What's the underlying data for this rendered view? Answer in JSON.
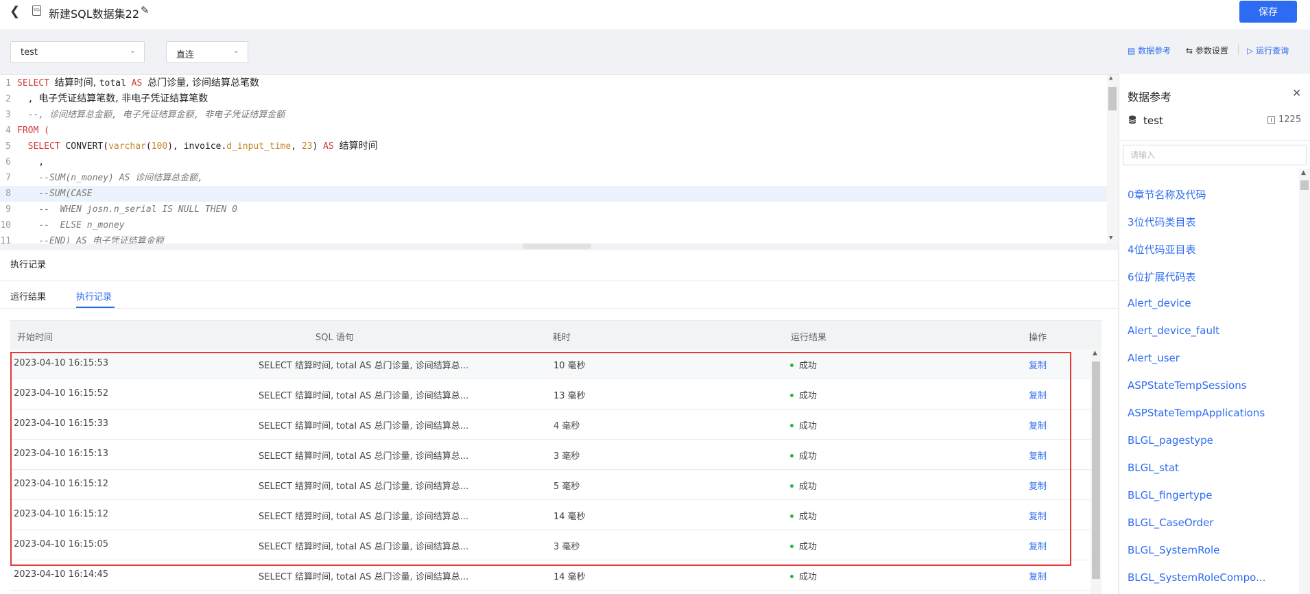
{
  "header": {
    "back_icon": "chevron-left-icon",
    "file_icon": "sql-file-icon",
    "title": "新建SQL数据集22",
    "edit_icon": "pencil-icon",
    "save_label": "保存"
  },
  "toolbar": {
    "datasource_select": "test",
    "mode_select": "直连",
    "data_reference": "数据参考",
    "param_settings": "参数设置",
    "run_query": "运行查询"
  },
  "editor": {
    "highlighted_line": 8,
    "lines": [
      {
        "n": "1",
        "parts": [
          {
            "t": "SELECT ",
            "c": "kw"
          },
          {
            "t": "结算时间, ",
            "c": "cn"
          },
          {
            "t": "total ",
            "c": ""
          },
          {
            "t": "AS ",
            "c": "kw"
          },
          {
            "t": "总门诊量, 诊间结算总笔数",
            "c": "cn"
          }
        ]
      },
      {
        "n": "2",
        "parts": [
          {
            "t": "  , ",
            "c": ""
          },
          {
            "t": "电子凭证结算笔数, 非电子凭证结算笔数",
            "c": "cn"
          }
        ]
      },
      {
        "n": "3",
        "parts": [
          {
            "t": "  --, 诊间结算总金额, 电子凭证结算金额, 非电子凭证结算金额",
            "c": "cm"
          }
        ]
      },
      {
        "n": "4",
        "parts": [
          {
            "t": "FROM (",
            "c": "kw"
          }
        ]
      },
      {
        "n": "5",
        "parts": [
          {
            "t": "  SELECT ",
            "c": "kw"
          },
          {
            "t": "CONVERT(",
            "c": ""
          },
          {
            "t": "varchar",
            "c": "fn"
          },
          {
            "t": "(",
            "c": ""
          },
          {
            "t": "100",
            "c": "fn"
          },
          {
            "t": "), invoice.",
            "c": ""
          },
          {
            "t": "d_input_time",
            "c": "fn"
          },
          {
            "t": ", ",
            "c": ""
          },
          {
            "t": "23",
            "c": "fn"
          },
          {
            "t": ") ",
            "c": ""
          },
          {
            "t": "AS ",
            "c": "kw"
          },
          {
            "t": "结算时间",
            "c": "cn"
          }
        ]
      },
      {
        "n": "6",
        "parts": [
          {
            "t": "    ,",
            "c": ""
          }
        ]
      },
      {
        "n": "7",
        "parts": [
          {
            "t": "    --SUM(n_money) AS 诊间结算总金额,",
            "c": "cm"
          }
        ]
      },
      {
        "n": "8",
        "parts": [
          {
            "t": "    --SUM(CASE",
            "c": "cm"
          }
        ]
      },
      {
        "n": "9",
        "parts": [
          {
            "t": "    --  WHEN josn.n_serial IS NULL THEN 0",
            "c": "cm"
          }
        ]
      },
      {
        "n": "10",
        "parts": [
          {
            "t": "    --  ELSE n_money",
            "c": "cm"
          }
        ]
      },
      {
        "n": "11",
        "parts": [
          {
            "t": "    --END) AS 电子凭证结算金额",
            "c": "cm"
          }
        ]
      }
    ]
  },
  "results": {
    "section_title": "执行记录",
    "tabs": [
      "运行结果",
      "执行记录"
    ],
    "active_tab": 1,
    "columns": [
      "开始时间",
      "SQL 语句",
      "耗时",
      "运行结果",
      "操作"
    ],
    "rows": [
      {
        "time": "2023-04-10 16:15:53",
        "sql": "SELECT 结算时间, total AS 总门诊量, 诊间结算总...",
        "duration": "10 毫秒",
        "status": "成功",
        "action": "复制"
      },
      {
        "time": "2023-04-10 16:15:52",
        "sql": "SELECT 结算时间, total AS 总门诊量, 诊间结算总...",
        "duration": "13 毫秒",
        "status": "成功",
        "action": "复制"
      },
      {
        "time": "2023-04-10 16:15:33",
        "sql": "SELECT 结算时间, total AS 总门诊量, 诊间结算总...",
        "duration": "4 毫秒",
        "status": "成功",
        "action": "复制"
      },
      {
        "time": "2023-04-10 16:15:13",
        "sql": "SELECT 结算时间, total AS 总门诊量, 诊间结算总...",
        "duration": "3 毫秒",
        "status": "成功",
        "action": "复制"
      },
      {
        "time": "2023-04-10 16:15:12",
        "sql": "SELECT 结算时间, total AS 总门诊量, 诊间结算总...",
        "duration": "5 毫秒",
        "status": "成功",
        "action": "复制"
      },
      {
        "time": "2023-04-10 16:15:12",
        "sql": "SELECT 结算时间, total AS 总门诊量, 诊间结算总...",
        "duration": "14 毫秒",
        "status": "成功",
        "action": "复制"
      },
      {
        "time": "2023-04-10 16:15:05",
        "sql": "SELECT 结算时间, total AS 总门诊量, 诊间结算总...",
        "duration": "3 毫秒",
        "status": "成功",
        "action": "复制"
      },
      {
        "time": "2023-04-10 16:14:45",
        "sql": "SELECT 结算时间, total AS 总门诊量, 诊间结算总...",
        "duration": "14 毫秒",
        "status": "成功",
        "action": "复制"
      }
    ]
  },
  "side_panel": {
    "title": "数据参考",
    "db_name": "test",
    "table_count": "1225",
    "search_placeholder": "请输入",
    "items": [
      "0章节名称及代码",
      "3位代码类目表",
      "4位代码亚目表",
      "6位扩展代码表",
      "Alert_device",
      "Alert_device_fault",
      "Alert_user",
      "ASPStateTempSessions",
      "ASPStateTempApplications",
      "BLGL_pagestype",
      "BLGL_stat",
      "BLGL_fingertype",
      "BLGL_CaseOrder",
      "BLGL_SystemRole",
      "BLGL_SystemRoleCompo..."
    ]
  },
  "colors": {
    "primary": "#2d6cf2",
    "success": "#2bb24c",
    "highlight_border": "#e53935"
  }
}
